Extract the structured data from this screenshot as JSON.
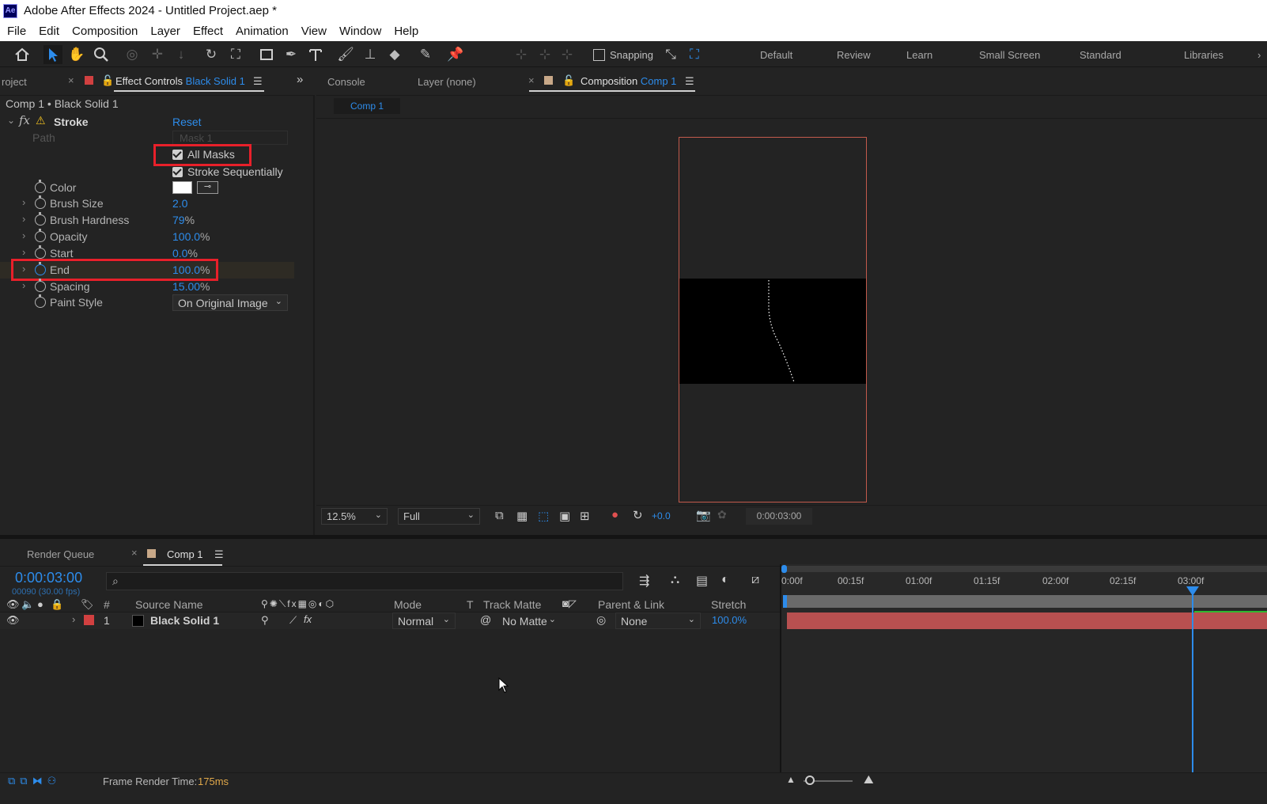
{
  "window": {
    "title": "Adobe After Effects 2024 - Untitled Project.aep *",
    "logo_text": "Ae"
  },
  "menu": [
    "File",
    "Edit",
    "Composition",
    "Layer",
    "Effect",
    "Animation",
    "View",
    "Window",
    "Help"
  ],
  "toolbar": {
    "snapping_label": "Snapping",
    "workspaces": [
      "Default",
      "Review",
      "Learn",
      "Small Screen",
      "Standard",
      "Libraries"
    ]
  },
  "left_panel": {
    "project_tab": "roject",
    "effect_controls_tab": "Effect Controls",
    "effect_controls_layer": "Black Solid 1",
    "header": "Comp 1 • Black Solid 1",
    "effect_name": "Stroke",
    "reset_label": "Reset",
    "path_label": "Path",
    "path_value": "Mask 1",
    "all_masks_label": "All Masks",
    "stroke_seq_label": "Stroke Sequentially",
    "color_label": "Color",
    "color_value": "#ffffff",
    "properties": [
      {
        "label": "Brush Size",
        "value": "2.0",
        "unit": ""
      },
      {
        "label": "Brush Hardness",
        "value": "79",
        "unit": "%"
      },
      {
        "label": "Opacity",
        "value": "100.0",
        "unit": "%"
      },
      {
        "label": "Start",
        "value": "0.0",
        "unit": "%"
      },
      {
        "label": "End",
        "value": "100.0",
        "unit": "%"
      },
      {
        "label": "Spacing",
        "value": "15.00",
        "unit": "%"
      }
    ],
    "paint_style_label": "Paint Style",
    "paint_style_value": "On Original Image"
  },
  "viewer": {
    "tabs": {
      "console": "Console",
      "layer": "Layer (none)",
      "composition": "Composition",
      "comp_name": "Comp 1"
    },
    "breadcrumb": "Comp 1",
    "zoom": "12.5%",
    "resolution": "Full",
    "exposure": "+0.0",
    "timecode": "0:00:03:00"
  },
  "timeline": {
    "render_queue_tab": "Render Queue",
    "comp_tab": "Comp 1",
    "current_time": "0:00:03:00",
    "frame_info": "00090 (30.00 fps)",
    "search_placeholder": "",
    "columns": {
      "hash": "#",
      "source_name": "Source Name",
      "mode": "Mode",
      "t": "T",
      "track_matte": "Track Matte",
      "parent": "Parent & Link",
      "stretch": "Stretch"
    },
    "layers": [
      {
        "index": "1",
        "name": "Black Solid 1",
        "mode": "Normal",
        "matte": "No Matte",
        "parent": "None",
        "stretch": "100.0%"
      }
    ],
    "ruler": [
      "0:00f",
      "00:15f",
      "01:00f",
      "01:15f",
      "02:00f",
      "02:15f",
      "03:00f"
    ],
    "playhead_position": 1.0
  },
  "status": {
    "frame_render_label": "Frame Render Time:",
    "frame_render_value": "175ms"
  }
}
